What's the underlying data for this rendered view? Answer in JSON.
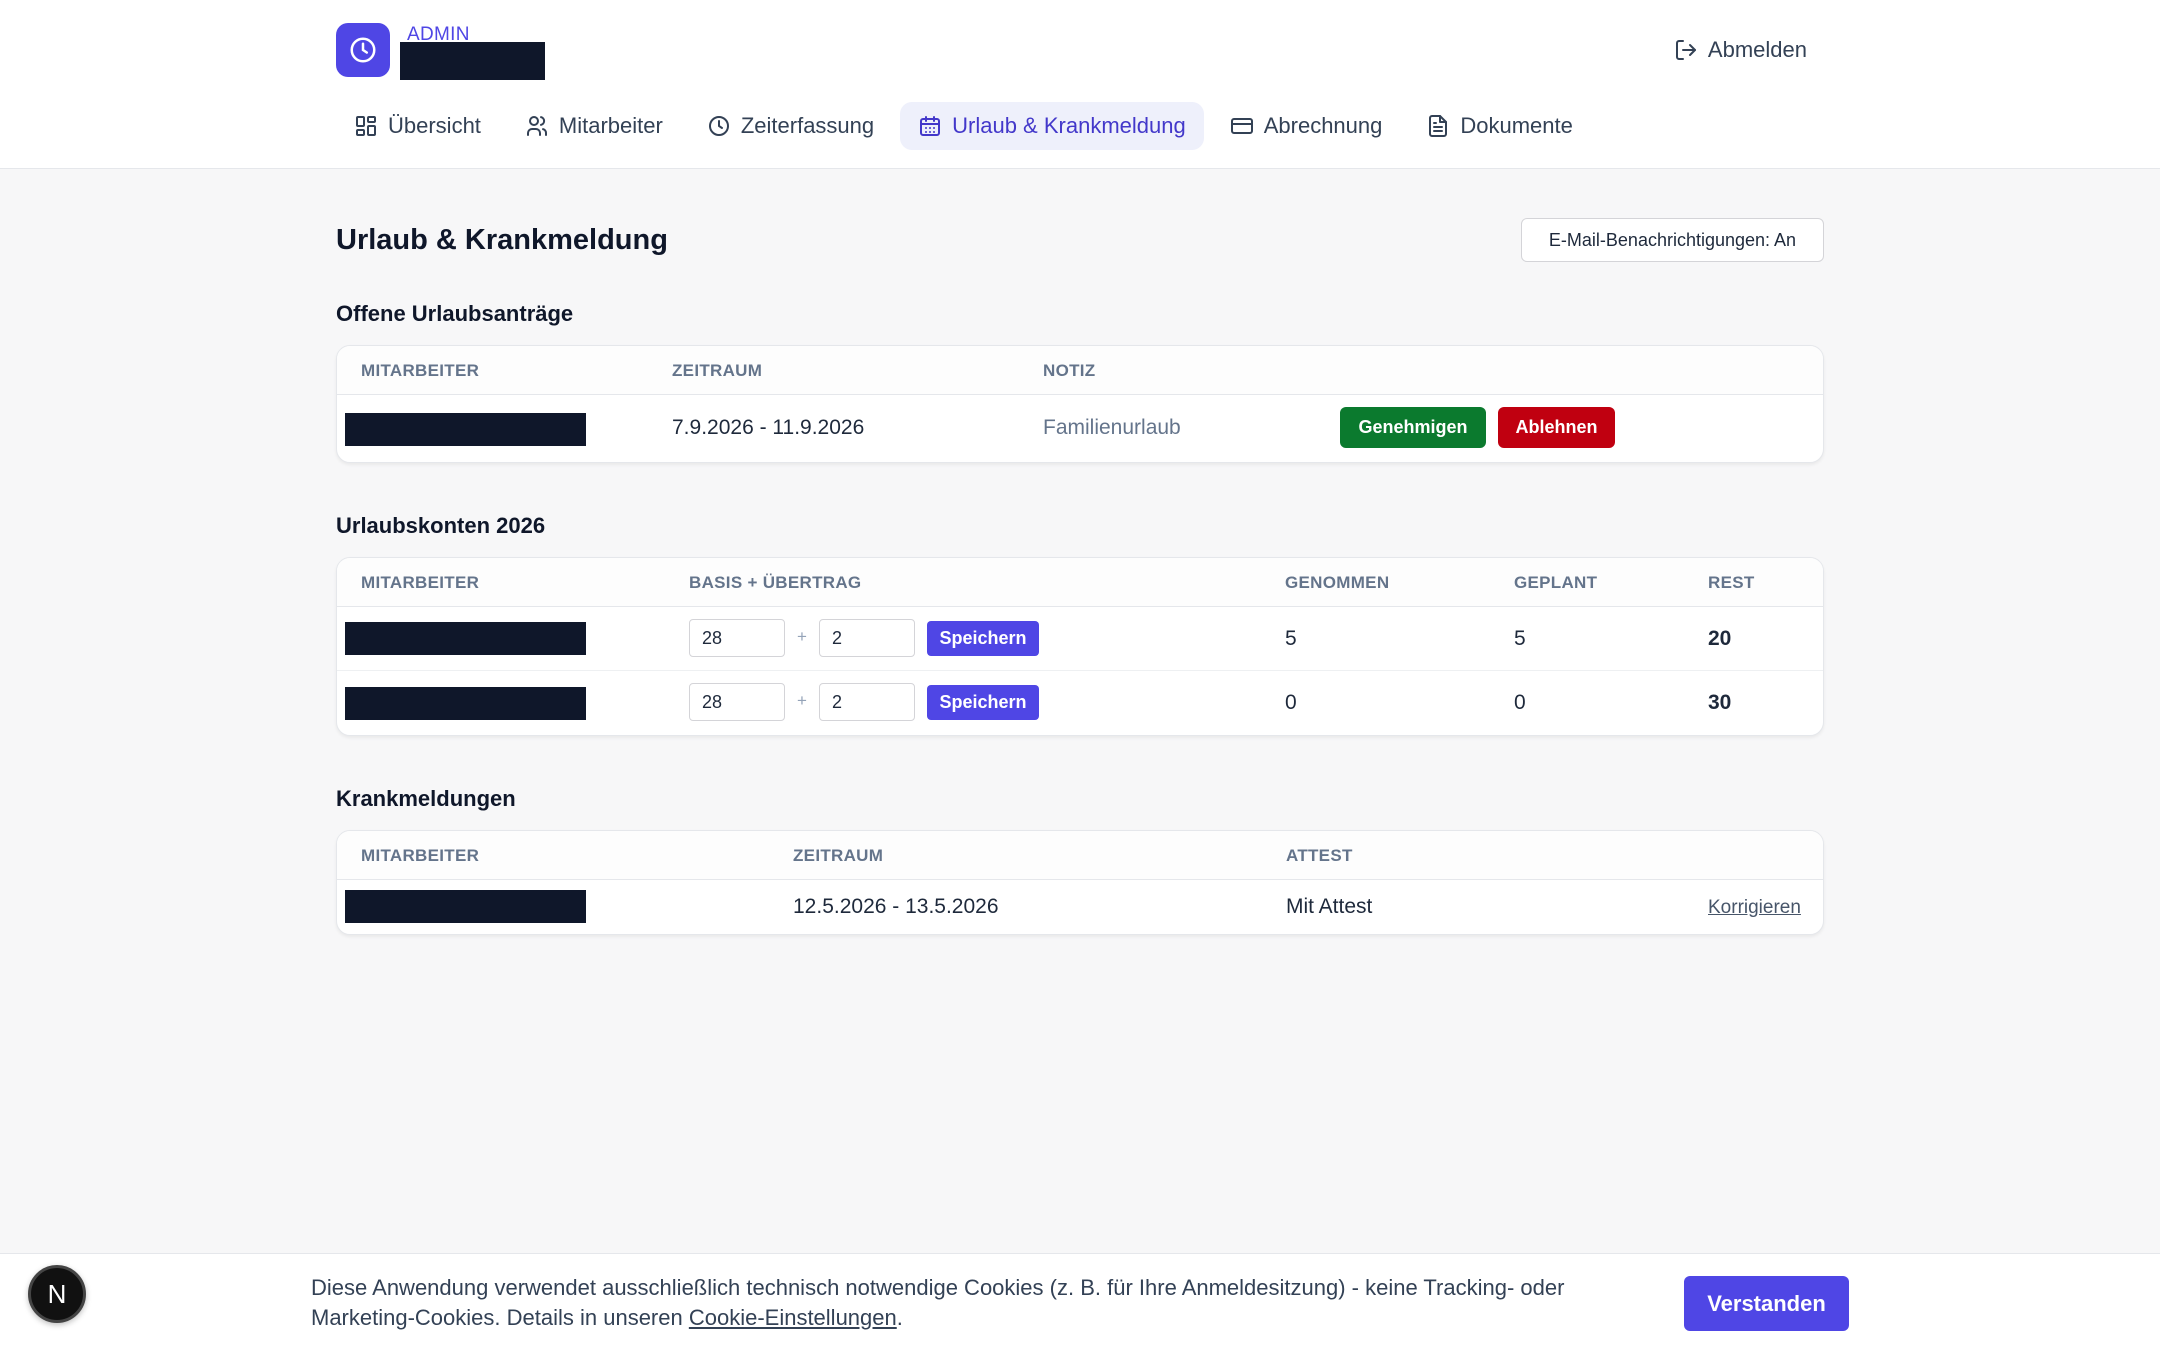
{
  "header": {
    "role_label": "ADMIN",
    "logout_label": "Abmelden"
  },
  "nav": [
    {
      "label": "Übersicht",
      "icon": "grid-icon"
    },
    {
      "label": "Mitarbeiter",
      "icon": "users-icon"
    },
    {
      "label": "Zeiterfassung",
      "icon": "clock-icon"
    },
    {
      "label": "Urlaub & Krankmeldung",
      "icon": "calendar-icon",
      "active": true
    },
    {
      "label": "Abrechnung",
      "icon": "credit-card-icon"
    },
    {
      "label": "Dokumente",
      "icon": "document-icon"
    }
  ],
  "page": {
    "title": "Urlaub & Krankmeldung",
    "email_toggle_label": "E-Mail-Benachrichtigungen: An"
  },
  "open_requests": {
    "title": "Offene Urlaubsanträge",
    "headers": [
      "MITARBEITER",
      "ZEITRAUM",
      "NOTIZ"
    ],
    "rows": [
      {
        "period": "7.9.2026 - 11.9.2026",
        "note": "Familienurlaub",
        "approve_label": "Genehmigen",
        "reject_label": "Ablehnen"
      }
    ]
  },
  "accounts": {
    "title": "Urlaubskonten 2026",
    "headers": [
      "MITARBEITER",
      "BASIS + ÜBERTRAG",
      "GENOMMEN",
      "GEPLANT",
      "REST"
    ],
    "plus_sign": "+",
    "save_label": "Speichern",
    "rows": [
      {
        "base": "28",
        "carryover": "2",
        "taken": "5",
        "planned": "5",
        "rest": "20"
      },
      {
        "base": "28",
        "carryover": "2",
        "taken": "0",
        "planned": "0",
        "rest": "30"
      }
    ]
  },
  "sick": {
    "title": "Krankmeldungen",
    "headers": [
      "MITARBEITER",
      "ZEITRAUM",
      "ATTEST"
    ],
    "rows": [
      {
        "period": "12.5.2026 - 13.5.2026",
        "certificate": "Mit Attest",
        "action_label": "Korrigieren"
      }
    ]
  },
  "cookie": {
    "text": "Diese Anwendung verwendet ausschließlich technisch notwendige Cookies (z. B. für Ihre Anmeldesitzung) - keine Tracking- oder Marketing-Cookies. Details in unseren ",
    "link_label": "Cookie-Einstellungen",
    "suffix": ".",
    "button_label": "Verstanden"
  },
  "badge": {
    "letter": "N"
  },
  "colors": {
    "accent": "#4f46e5",
    "approve": "#0b7a2e",
    "reject": "#c00010"
  }
}
